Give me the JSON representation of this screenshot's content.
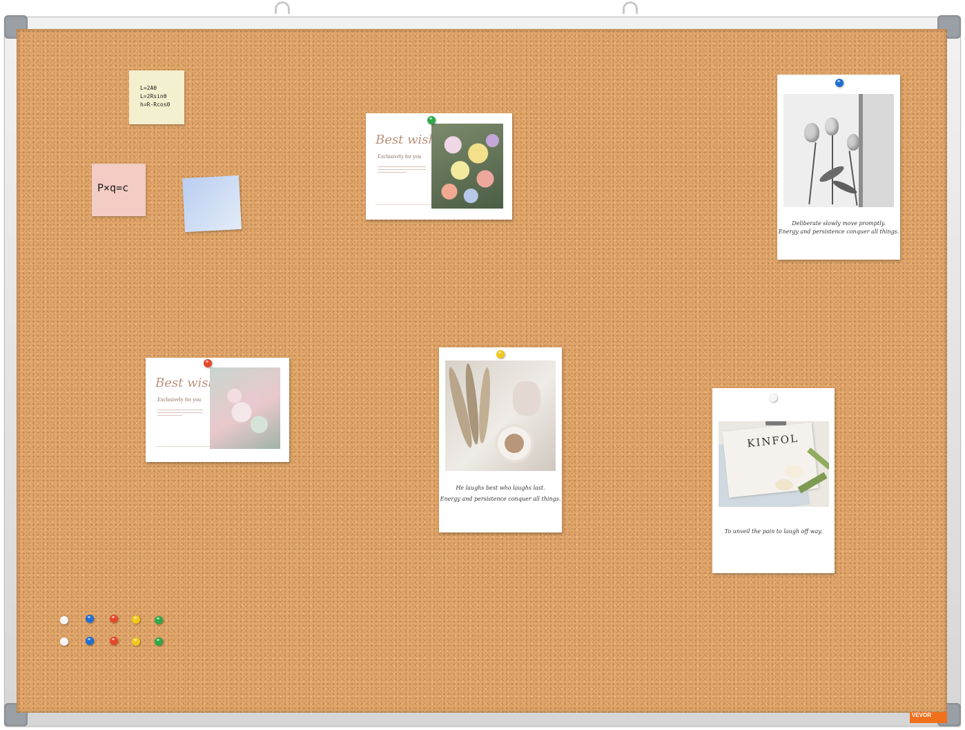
{
  "board": {
    "cork_color": "#e1a66a",
    "frame_color": "#d9d9d9",
    "brand": "VEVOR"
  },
  "sticky_notes": [
    {
      "text": "L=2Aθ\nL=2Rsinθ\nh=R-Rcosθ",
      "color": "#f3f0cf"
    },
    {
      "text": "P×q=c",
      "color": "#f3ccc4"
    },
    {
      "text": "",
      "color": "#cfe0f4"
    }
  ],
  "cards": {
    "best_wishes_1": {
      "title": "Best wish",
      "subtitle": "Exclusively for you"
    },
    "best_wishes_2": {
      "title": "Best wishe",
      "subtitle": "Exclusively for you"
    },
    "tulip_card": {
      "caption_1": "Deliberate slowly move promptly.",
      "caption_2": "Energy and persistence conquer all things."
    },
    "pampas_card": {
      "caption_1": "He laughs best who laughs last.",
      "caption_2": "Energy and persistence conquer all things."
    },
    "kinfolk_card": {
      "magazine_title": "KINFOL",
      "caption_1": "To unveil the pain to laugh off way."
    }
  },
  "pin_colors": [
    "#f4f4f4",
    "#1f6fd0",
    "#e4492a",
    "#f2c81c",
    "#2fa84a"
  ],
  "icons": [
    "hanging-hook-icon",
    "corner-cap-icon",
    "push-pin-icon"
  ]
}
